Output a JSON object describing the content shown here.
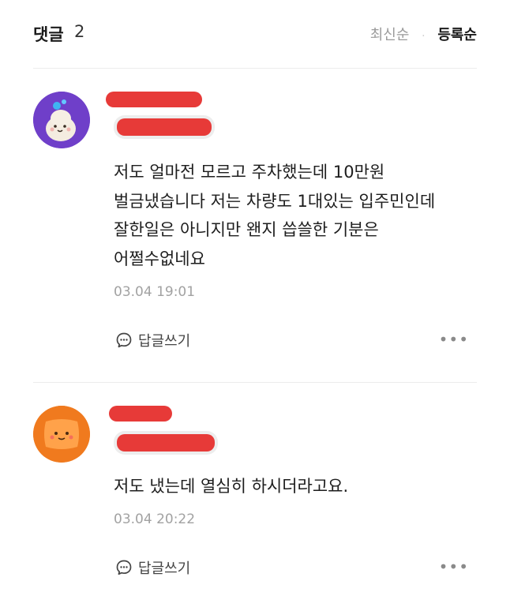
{
  "header": {
    "title": "댓글",
    "count": "2",
    "sort_options": [
      "최신순",
      "등록순"
    ],
    "active_sort": "등록순"
  },
  "comments": [
    {
      "text": "저도 얼마전 모르고 주차했는데 10만원\n벌금냈습니다 저는 차량도 1대있는 입주민인데\n잘한일은 아니지만 왠지 씁쓸한 기분은\n어쩔수없네요",
      "time": "03.04 19:01",
      "reply_label": "답글쓰기",
      "avatar_icon": "dumpling-character-icon"
    },
    {
      "text": "저도 냈는데 열심히 하시더라고요.",
      "time": "03.04 20:22",
      "reply_label": "답글쓰기",
      "avatar_icon": "cushion-character-icon"
    }
  ],
  "colors": {
    "redaction": "#e73a38",
    "avatar1_bg": "#6f3fc9",
    "avatar2_bg": "#f07a1e"
  }
}
